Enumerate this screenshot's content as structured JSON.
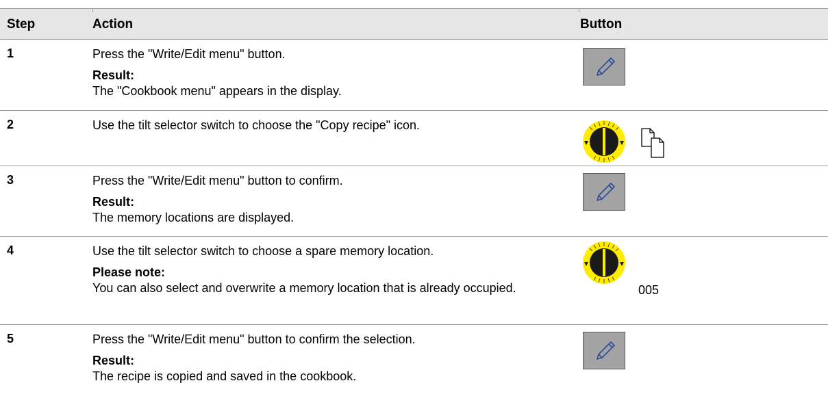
{
  "header": {
    "step": "Step",
    "action": "Action",
    "button": "Button"
  },
  "steps": [
    {
      "number": "1",
      "action": "Press the \"Write/Edit menu\" button.",
      "subheading": "Result:",
      "detail": "The \"Cookbook menu\" appears in the display.",
      "visual": "write-edit-button"
    },
    {
      "number": "2",
      "action": "Use the tilt selector switch to choose the \"Copy recipe\" icon.",
      "visual": "tilt-selector + copy-recipe-icon"
    },
    {
      "number": "3",
      "action": "Press the \"Write/Edit menu\" button to confirm.",
      "subheading": "Result:",
      "detail": "The memory locations are displayed.",
      "visual": "write-edit-button"
    },
    {
      "number": "4",
      "action": "Use the tilt selector switch to choose a spare memory location.",
      "subheading": "Please note:",
      "detail": "You can also select and overwrite a memory location that is already occupied.",
      "visual": "tilt-selector",
      "memory_value": "005"
    },
    {
      "number": "5",
      "action": "Press the \"Write/Edit menu\" button to confirm the selection.",
      "subheading": "Result:",
      "detail": "The recipe is copied and saved in the cookbook.",
      "visual": "write-edit-button"
    }
  ],
  "colors": {
    "button_gray": "#a3a3a3",
    "knob_yellow": "#ffec00",
    "pencil_blue": "#2b4a9a",
    "header_bg": "#e6e6e6"
  }
}
